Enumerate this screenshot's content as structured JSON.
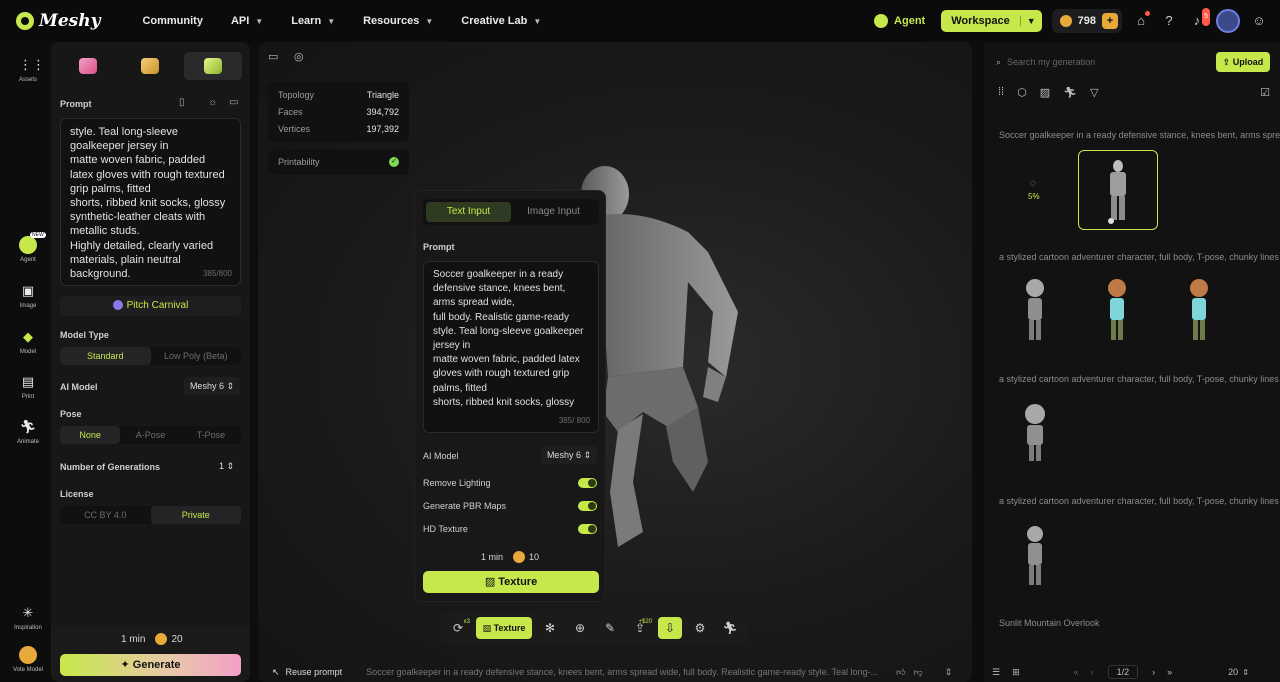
{
  "brand": "Meshy",
  "nav": [
    "Community",
    "API",
    "Learn",
    "Resources",
    "Creative Lab"
  ],
  "topbar": {
    "agent": "Agent",
    "workspace": "Workspace",
    "credits": "798",
    "notifications": "5",
    "plus": "+"
  },
  "rail": [
    {
      "label": "Assets"
    },
    {
      "label": "Agent",
      "badge": "NEW"
    },
    {
      "label": "Image"
    },
    {
      "label": "Model"
    },
    {
      "label": "Print"
    },
    {
      "label": "Animate"
    },
    {
      "label": "Inspiration"
    },
    {
      "label": "Vote Model"
    }
  ],
  "left": {
    "prompt_label": "Prompt",
    "prompt_text": "style. Teal long-sleeve goalkeeper jersey in\nmatte woven fabric, padded latex gloves with rough textured grip palms, fitted\nshorts, ribbed knit socks, glossy synthetic-leather cleats with metallic studs.\nHighly detailed, clearly varied materials, plain neutral background.",
    "prompt_counter": "385/800",
    "carnival": "Pitch Carnival",
    "model_type_label": "Model Type",
    "model_types": [
      "Standard",
      "Low Poly (Beta)"
    ],
    "ai_model_label": "AI Model",
    "ai_model": "Meshy 6",
    "pose_label": "Pose",
    "poses": [
      "None",
      "A-Pose",
      "T-Pose"
    ],
    "num_gen_label": "Number of Generations",
    "num_gen": "1",
    "license_label": "License",
    "licenses": [
      "CC BY 4.0",
      "Private"
    ],
    "time": "1 min",
    "cost": "20",
    "generate": "Generate"
  },
  "viewport": {
    "stats": [
      {
        "k": "Topology",
        "v": "Triangle"
      },
      {
        "k": "Faces",
        "v": "394,792"
      },
      {
        "k": "Vertices",
        "v": "197,392"
      }
    ],
    "printability": "Printability",
    "texture_panel": {
      "tabs": [
        "Text Input",
        "Image Input"
      ],
      "prompt_label": "Prompt",
      "prompt_text": "Soccer goalkeeper in a ready defensive stance, knees bent, arms spread wide,\nfull body. Realistic game-ready style. Teal long-sleeve goalkeeper jersey in\nmatte woven fabric, padded latex gloves with rough textured grip palms, fitted\nshorts, ribbed knit socks, glossy",
      "counter": "385/ 800",
      "ai_model_label": "AI Model",
      "ai_model": "Meshy 6",
      "toggles": [
        "Remove Lighting",
        "Generate PBR Maps",
        "HD Texture"
      ],
      "time": "1 min",
      "cost": "10",
      "button": "Texture"
    },
    "toolbar": {
      "texture": "Texture",
      "x3": "x3",
      "plus_cost": "+$20"
    },
    "reuse": "Reuse prompt",
    "reuse_text": "Soccer goalkeeper in a ready defensive stance, knees bent, arms spread wide, full body. Realistic game-ready style. Teal long-..."
  },
  "right": {
    "search_placeholder": "Search my generation",
    "upload": "Upload",
    "progress": "5%",
    "generations": [
      "Soccer goalkeeper in a ready defensive stance, knees bent, arms spread wide",
      "a stylized cartoon adventurer character, full body, T-pose, chunky lines",
      "a stylized cartoon adventurer character, full body, T-pose, chunky lines",
      "a stylized cartoon adventurer character, full body, T-pose, chunky lines",
      "Sunlit Mountain Overlook"
    ],
    "page": "1/2",
    "per_page": "20"
  },
  "colors": {
    "accent": "#c6e84a",
    "coin": "#e6a93a"
  }
}
